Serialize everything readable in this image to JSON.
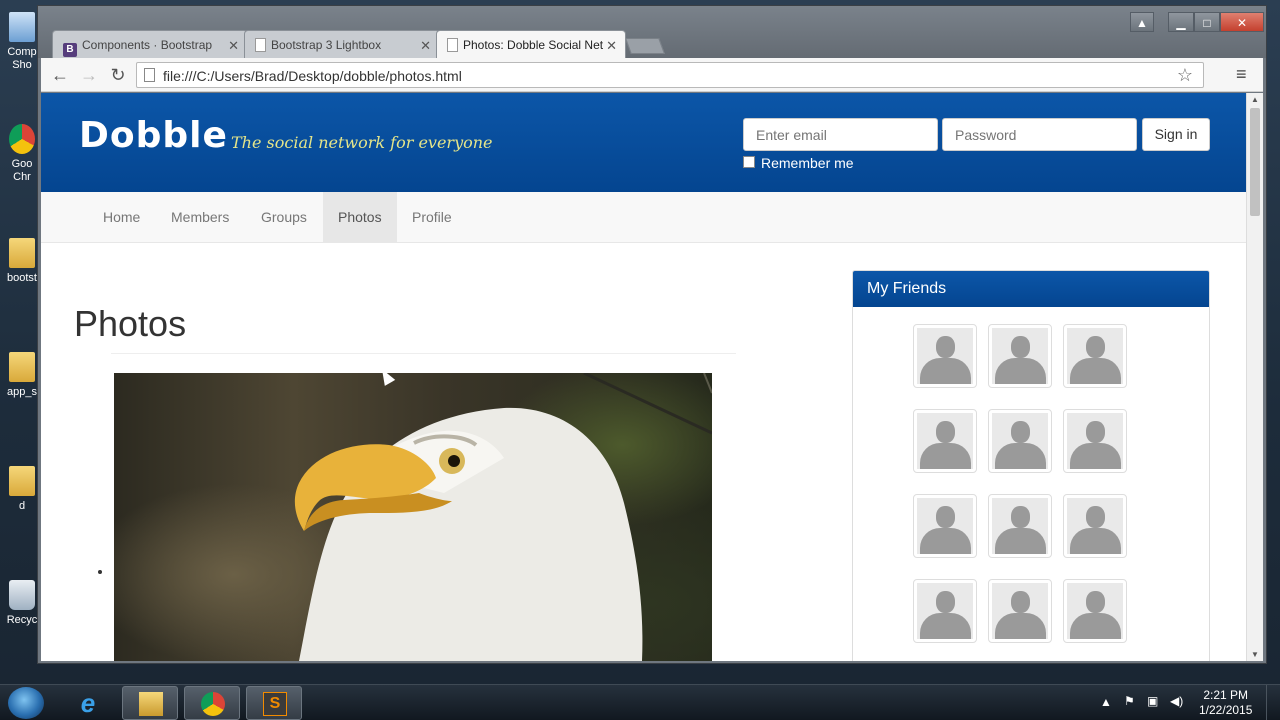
{
  "desktop": {
    "icons": [
      {
        "label": "Comp Sho",
        "icon": "computer-shortcut-icon"
      },
      {
        "label": "Goo Chr",
        "icon": "chrome-shortcut-icon"
      },
      {
        "label": "bootst",
        "icon": "folder-icon"
      },
      {
        "label": "app_s",
        "icon": "folder-icon"
      },
      {
        "label": "d",
        "icon": "folder-icon"
      },
      {
        "label": "Recyc",
        "icon": "recycle-bin-icon"
      }
    ]
  },
  "browser": {
    "tabs": [
      {
        "title": "Components · Bootstrap",
        "icon": "bootstrap-favicon"
      },
      {
        "title": "Bootstrap 3 Lightbox",
        "icon": "page-icon"
      },
      {
        "title": "Photos: Dobble Social Net",
        "icon": "page-icon"
      }
    ],
    "url": "file:///C:/Users/Brad/Desktop/dobble/photos.html"
  },
  "site": {
    "logo": "Dobble",
    "tagline": "The social network for everyone",
    "login": {
      "email_placeholder": "Enter email",
      "password_placeholder": "Password",
      "signin_label": "Sign in",
      "remember_label": "Remember me"
    },
    "nav": [
      "Home",
      "Members",
      "Groups",
      "Photos",
      "Profile"
    ],
    "active_nav": "Photos",
    "page_title": "Photos",
    "friends": {
      "title": "My Friends",
      "count": 12
    }
  },
  "taskbar": {
    "time": "2:21 PM",
    "date": "1/22/2015",
    "apps": [
      "internet-explorer-icon",
      "file-explorer-icon",
      "chrome-icon",
      "sublime-text-icon"
    ]
  },
  "colors": {
    "brand_blue": "#0c56a8",
    "tagline_yellow": "#e5e58a"
  }
}
